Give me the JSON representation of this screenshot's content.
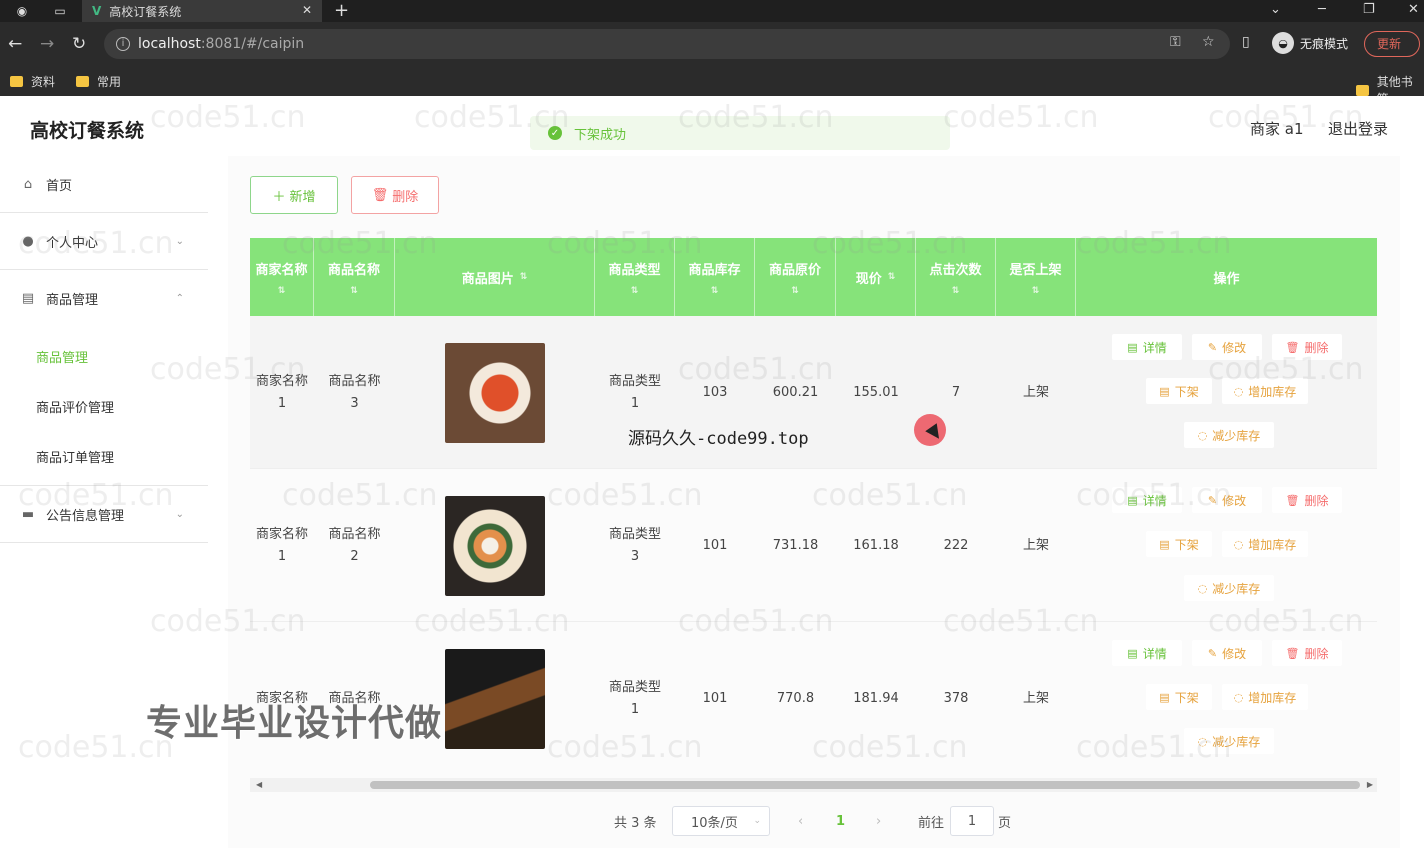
{
  "browser": {
    "tab_title": "高校订餐系统",
    "url_host": "localhost",
    "url_path": ":8081/#/caipin",
    "incognito_label": "无痕模式",
    "update_label": "更新",
    "bookmarks": [
      "资料",
      "常用"
    ],
    "other_bookmarks": "其他书签"
  },
  "app": {
    "title": "高校订餐系统",
    "user": "商家 a1",
    "logout": "退出登录",
    "toast": "下架成功"
  },
  "sidebar": {
    "home": "首页",
    "profile": "个人中心",
    "goods_group": "商品管理",
    "goods_sub": [
      "商品管理",
      "商品评价管理",
      "商品订单管理"
    ],
    "notice_group": "公告信息管理"
  },
  "toolbar": {
    "add": "新增",
    "delete": "删除"
  },
  "table": {
    "headers": [
      "商家名称",
      "商品名称",
      "商品图片",
      "商品类型",
      "商品库存",
      "商品原价",
      "现价",
      "点击次数",
      "是否上架",
      "操作"
    ],
    "rows": [
      {
        "merchant": [
          "商家名称",
          "1"
        ],
        "name": [
          "商品名称",
          "3"
        ],
        "type": [
          "商品类型",
          "1"
        ],
        "stock": "103",
        "orig": "600.21",
        "price": "155.01",
        "clicks": "7",
        "status": "上架"
      },
      {
        "merchant": [
          "商家名称",
          "1"
        ],
        "name": [
          "商品名称",
          "2"
        ],
        "type": [
          "商品类型",
          "3"
        ],
        "stock": "101",
        "orig": "731.18",
        "price": "161.18",
        "clicks": "222",
        "status": "上架"
      },
      {
        "merchant": [
          "商家名称",
          ""
        ],
        "name": [
          "商品名称",
          ""
        ],
        "type": [
          "商品类型",
          "1"
        ],
        "stock": "101",
        "orig": "770.8",
        "price": "181.94",
        "clicks": "378",
        "status": "上架"
      }
    ],
    "ops": {
      "detail": "详情",
      "edit": "修改",
      "del": "删除",
      "off": "下架",
      "add_stock": "增加库存",
      "dec_stock": "减少库存"
    }
  },
  "pager": {
    "total": "共 3 条",
    "size": "10条/页",
    "current": "1",
    "goto": "前往",
    "goto_value": "1",
    "page_unit": "页"
  },
  "overlays": {
    "watermark": "code51.cn",
    "source_caption": "源码久久-code99.top",
    "promo": "专业毕业设计代做"
  }
}
